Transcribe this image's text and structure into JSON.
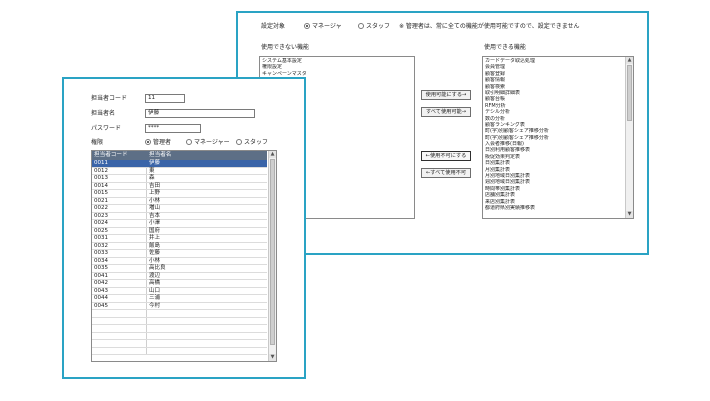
{
  "back_window": {
    "setting_target_label": "設定対象",
    "radio_manager": "マネージャ",
    "radio_staff": "スタッフ",
    "notice": "※ 管理者は、常に全ての機能が使用可能ですので、設定できません",
    "unusable_label": "使用できない機能",
    "usable_label": "使用できる機能",
    "unusable_items": [
      "システム基本設定",
      "権限設定",
      "キャンペーンマスタ"
    ],
    "usable_items": [
      "カードデータ取込処理",
      "会員管理",
      "顧客登録",
      "顧客情報",
      "顧客検索",
      "取引明細詳細表",
      "顧客台帳",
      "RFM分析",
      "デシル分析",
      "数の分析",
      "顧客ランキング表",
      "町(字)別顧客シェア推移分析",
      "町(字)別顧客シェア推移分析",
      "入会者推移(日報)",
      "日別利用顧客推移表",
      "販促効果判定表",
      "日別集計表",
      "月別集計表",
      "月別地域日別集計表",
      "週別地域日別集計表",
      "時間帯別集計表",
      "店舗別集計表",
      "来店別集計表",
      "都道府県別実績推移表"
    ],
    "btn_enable": "使用可能にする→",
    "btn_enable_all": "すべて使用可能→",
    "btn_disable": "←使用不可にする",
    "btn_disable_all": "←すべて使用不可"
  },
  "front_window": {
    "code_label": "担当者コード",
    "code_value": "11",
    "name_label": "担当者名",
    "name_value": "伊藤",
    "password_label": "パスワード",
    "password_value": "****",
    "role_label": "権限",
    "role_admin": "管理者",
    "role_manager": "マネージャー",
    "role_staff": "スタッフ",
    "grid_header_code": "担当者コード",
    "grid_header_name": "担当者名",
    "rows": [
      {
        "code": "0011",
        "name": "伊藤"
      },
      {
        "code": "0012",
        "name": "東"
      },
      {
        "code": "0013",
        "name": "森"
      },
      {
        "code": "0014",
        "name": "吉田"
      },
      {
        "code": "0015",
        "name": "上野"
      },
      {
        "code": "0021",
        "name": "小林"
      },
      {
        "code": "0022",
        "name": "増山"
      },
      {
        "code": "0023",
        "name": "吉本"
      },
      {
        "code": "0024",
        "name": "小澤"
      },
      {
        "code": "0025",
        "name": "国府"
      },
      {
        "code": "0031",
        "name": "井上"
      },
      {
        "code": "0032",
        "name": "飯島"
      },
      {
        "code": "0033",
        "name": "佐藤"
      },
      {
        "code": "0034",
        "name": "小林"
      },
      {
        "code": "0035",
        "name": "高比良"
      },
      {
        "code": "0041",
        "name": "渡辺"
      },
      {
        "code": "0042",
        "name": "高橋"
      },
      {
        "code": "0043",
        "name": "山口"
      },
      {
        "code": "0044",
        "name": "三浦"
      },
      {
        "code": "0045",
        "name": "今村"
      }
    ]
  }
}
